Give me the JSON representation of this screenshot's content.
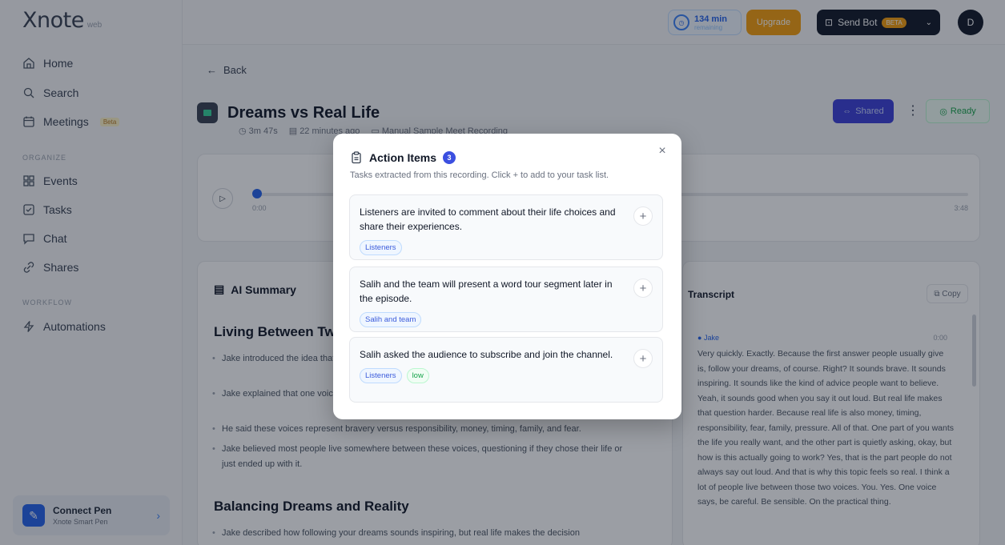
{
  "brand": {
    "name": "Xnote",
    "suffix": "web"
  },
  "nav": {
    "home": "Home",
    "search": "Search",
    "meetings": "Meetings",
    "meetings_badge": "Beta",
    "section_organize": "ORGANIZE",
    "events": "Events",
    "tasks": "Tasks",
    "chat": "Chat",
    "shares": "Shares",
    "section_workflow": "WORKFLOW",
    "automations": "Automations"
  },
  "connect_pen": {
    "title": "Connect Pen",
    "subtitle": "Xnote Smart Pen"
  },
  "topbar": {
    "usage_value": "134 min",
    "usage_sub": "remaining",
    "upgrade": "Upgrade",
    "send_bot": "Send Bot",
    "beta": "BETA",
    "avatar_initial": "D"
  },
  "recording": {
    "back": "Back",
    "title": "Dreams vs Real Life",
    "duration": "3m 47s",
    "date": "22 minutes ago",
    "source": "Manual Sample Meet Recording",
    "shared": "Shared",
    "status": "Ready",
    "time_start": "0:00",
    "time_end": "3:48"
  },
  "summary": {
    "heading": "AI Summary",
    "section1": "Living Between Two Voices",
    "bullets1": [
      "Jake introduced the idea that people live between two voices when making life decisions.",
      "Jake explained that one voice says to follow your dreams, while the other urges caution and practicality.",
      "He said these voices represent bravery versus responsibility, money, timing, family, and fear.",
      "Jake believed most people live somewhere between these voices, questioning if they chose their life or just ended up with it."
    ],
    "section2": "Balancing Dreams and Reality",
    "bullets2": [
      "Jake described how following your dreams sounds inspiring, but real life makes the decision"
    ]
  },
  "transcript": {
    "heading": "Transcript",
    "copy": "Copy",
    "speaker": "Jake",
    "time": "0:00",
    "text": "Very quickly. Exactly. Because the first answer people usually give is, follow your dreams, of course. Right? It sounds brave. It sounds inspiring. It sounds like the kind of advice people want to believe. Yeah, it sounds good when you say it out loud. But real life makes that question harder. Because real life is also money, timing, responsibility, fear, family, pressure. All of that. One part of you wants the life you really want, and the other part is quietly asking, okay, but how is this actually going to work? Yes, that is the part people do not always say out loud. And that is why this topic feels so real. I think a lot of people live between those two voices. You. Yes. One voice says, be careful. Be sensible. On the practical thing."
  },
  "modal": {
    "title": "Action Items",
    "count": "3",
    "subtitle": "Tasks extracted from this recording. Click + to add to your task list.",
    "items": [
      {
        "text": "Listeners are invited to comment about their life choices and share their experiences.",
        "tags": [
          "Listeners"
        ]
      },
      {
        "text": "Salih and the team will present a word tour segment later in the episode.",
        "tags": [
          "Salih and team"
        ]
      },
      {
        "text": "Salih asked the audience to subscribe and join the channel.",
        "tags": [
          "Listeners",
          "low"
        ]
      }
    ]
  }
}
